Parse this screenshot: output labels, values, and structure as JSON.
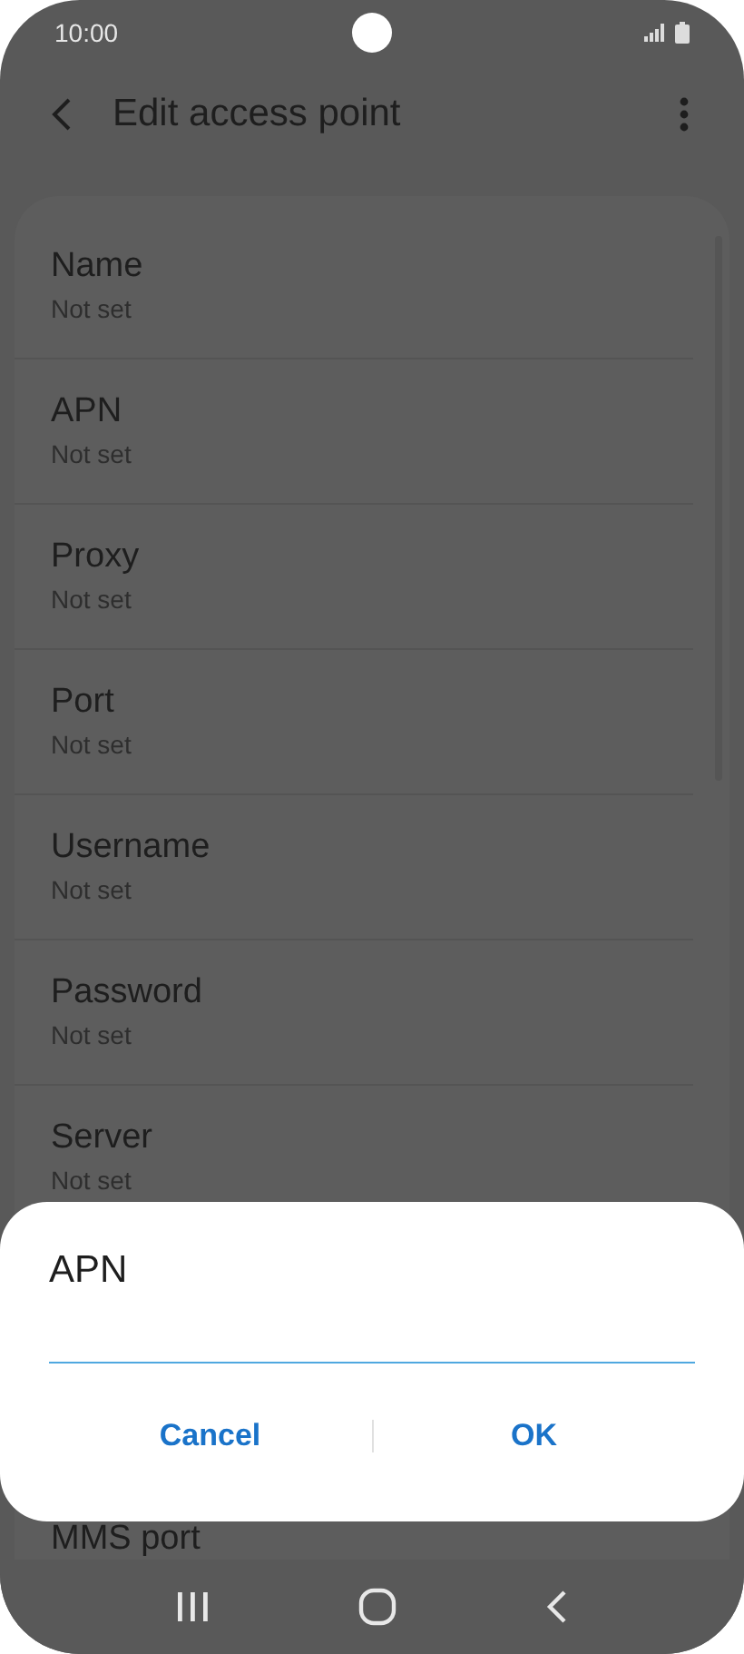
{
  "status_bar": {
    "time": "10:00"
  },
  "toolbar": {
    "title": "Edit access point"
  },
  "fields": [
    {
      "label": "Name",
      "value": "Not set"
    },
    {
      "label": "APN",
      "value": "Not set"
    },
    {
      "label": "Proxy",
      "value": "Not set"
    },
    {
      "label": "Port",
      "value": "Not set"
    },
    {
      "label": "Username",
      "value": "Not set"
    },
    {
      "label": "Password",
      "value": "Not set"
    },
    {
      "label": "Server",
      "value": "Not set"
    }
  ],
  "partial_field": {
    "label": "MMS port"
  },
  "dialog": {
    "title": "APN",
    "buttons": [
      "Cancel",
      "OK"
    ]
  }
}
